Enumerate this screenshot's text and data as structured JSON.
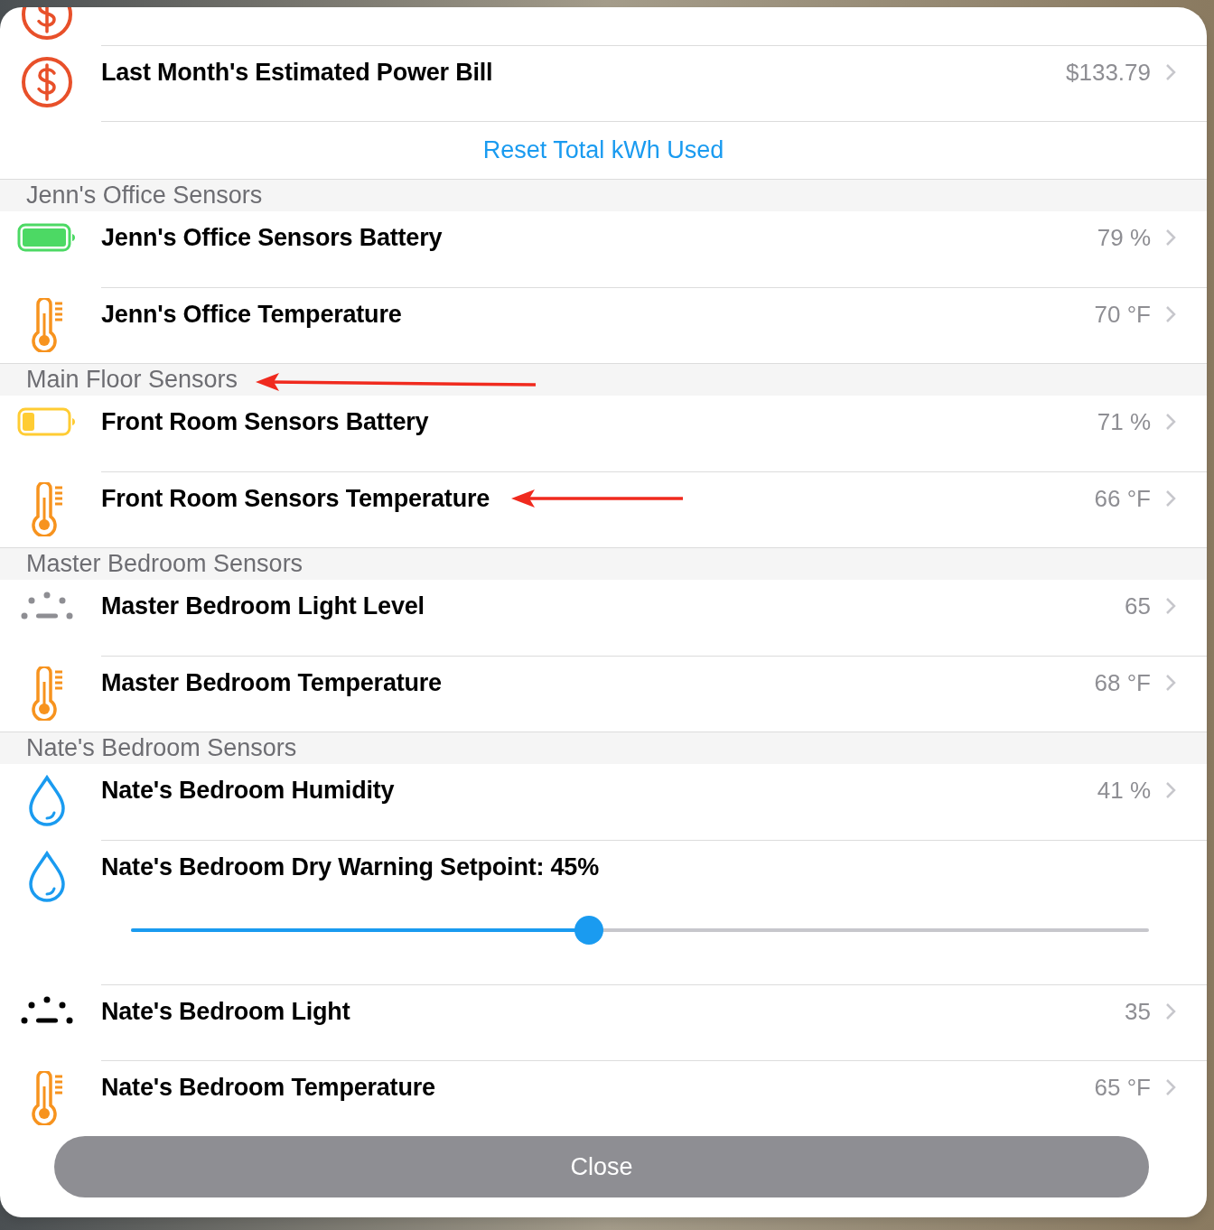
{
  "partial_row": {
    "kind": "money"
  },
  "top_rows": [
    {
      "kind": "money",
      "title": "Last Month's Estimated Power Bill",
      "value": "$133.79",
      "annotated": false
    },
    {
      "kind": "link",
      "title": "Reset Total kWh Used"
    }
  ],
  "sections": [
    {
      "header": "Jenn's Office Sensors",
      "annotated": false,
      "rows": [
        {
          "kind": "battery",
          "low": false,
          "title": "Jenn's Office Sensors Battery",
          "value": "79 %",
          "annotated": false
        },
        {
          "kind": "temperature",
          "title": "Jenn's Office Temperature",
          "value": "70 °F",
          "annotated": false
        }
      ]
    },
    {
      "header": "Main Floor Sensors",
      "annotated": true,
      "rows": [
        {
          "kind": "battery",
          "low": true,
          "title": "Front Room Sensors Battery",
          "value": "71 %",
          "annotated": false
        },
        {
          "kind": "temperature",
          "title": "Front Room Sensors Temperature",
          "value": "66 °F",
          "annotated": true
        }
      ]
    },
    {
      "header": "Master Bedroom Sensors",
      "annotated": false,
      "rows": [
        {
          "kind": "light",
          "dimmed": true,
          "title": "Master Bedroom Light Level",
          "value": "65",
          "annotated": false
        },
        {
          "kind": "temperature",
          "title": "Master Bedroom Temperature",
          "value": "68 °F",
          "annotated": false
        }
      ]
    },
    {
      "header": "Nate's Bedroom Sensors",
      "annotated": false,
      "rows": [
        {
          "kind": "humidity",
          "title": "Nate's Bedroom Humidity",
          "value": "41 %",
          "annotated": false
        },
        {
          "kind": "setpoint",
          "title": "Nate's Bedroom Dry Warning Setpoint: 45%",
          "level": 0.45
        },
        {
          "kind": "light",
          "dimmed": false,
          "title": "Nate's Bedroom Light",
          "value": "35",
          "annotated": false
        },
        {
          "kind": "temperature",
          "title": "Nate's Bedroom Temperature",
          "value": "65 °F",
          "annotated": false
        }
      ]
    }
  ],
  "close_button": "Close"
}
